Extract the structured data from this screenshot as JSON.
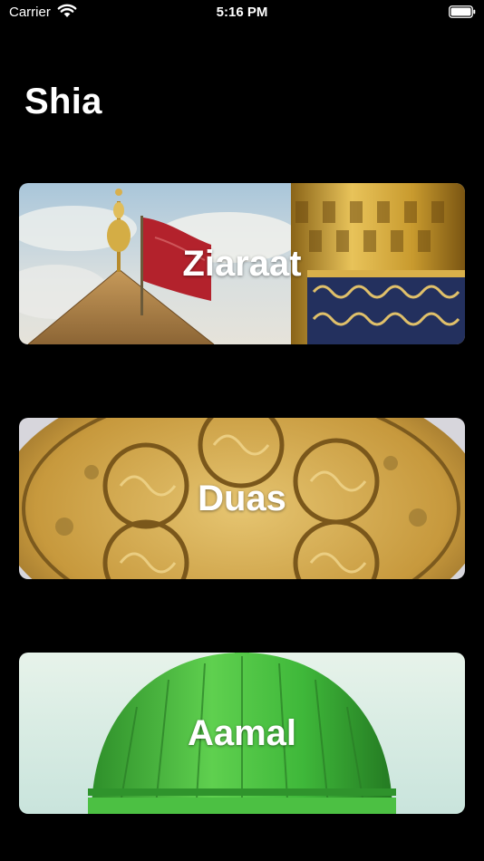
{
  "status_bar": {
    "carrier": "Carrier",
    "time": "5:16 PM",
    "icons": [
      "wifi-icon",
      "battery-icon"
    ]
  },
  "header": {
    "title": "Shia"
  },
  "cards": [
    {
      "label": "Ziaraat",
      "image": "shrine-dome-flag-minaret"
    },
    {
      "label": "Duas",
      "image": "golden-calligraphy-carving"
    },
    {
      "label": "Aamal",
      "image": "green-dome"
    }
  ],
  "colors": {
    "background": "#000000",
    "text": "#ffffff",
    "dome_green": "#3fb83a",
    "gold": "#c9a33c"
  }
}
